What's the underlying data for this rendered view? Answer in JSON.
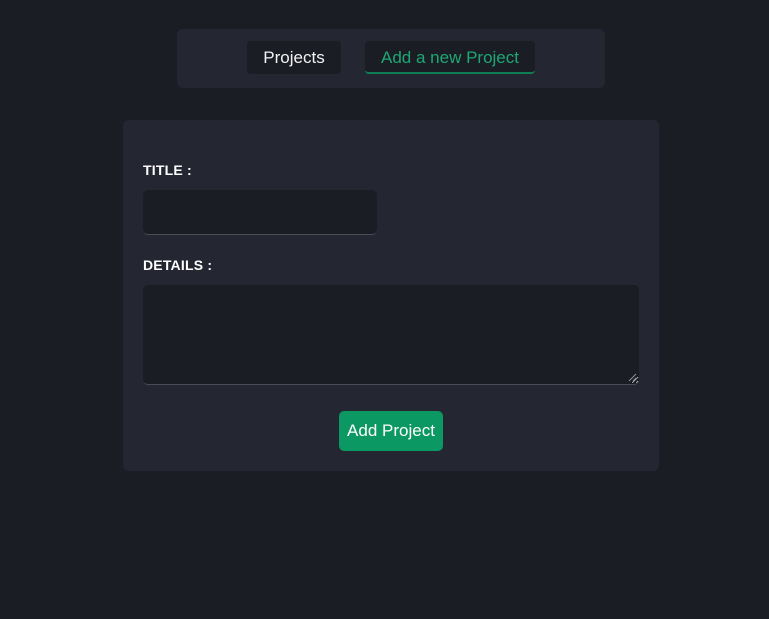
{
  "nav": {
    "tabs": [
      {
        "label": "Projects",
        "active": false
      },
      {
        "label": "Add a new Project",
        "active": true
      }
    ]
  },
  "form": {
    "title_label": "TITLE :",
    "title_value": "",
    "details_label": "DETAILS :",
    "details_value": "",
    "submit_label": "Add Project"
  },
  "colors": {
    "background": "#1b1d25",
    "panel": "#242631",
    "accent": "#0c9862",
    "accent_text": "#1ea773"
  }
}
